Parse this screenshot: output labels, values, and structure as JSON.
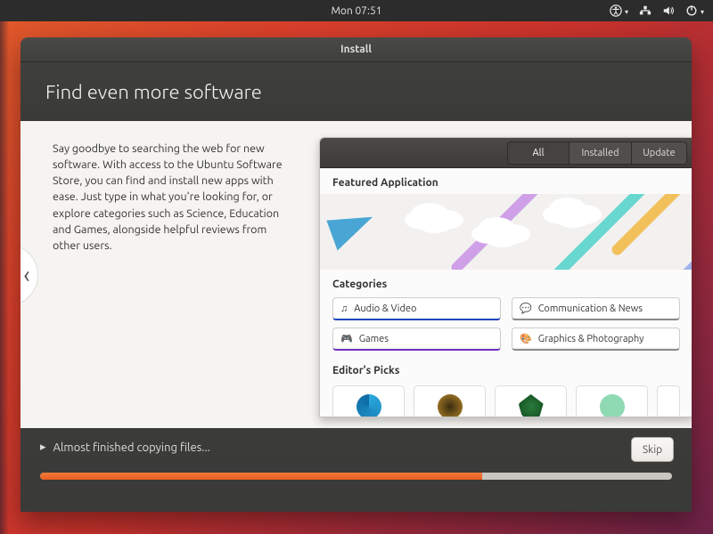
{
  "panel": {
    "clock": "Mon 07:51"
  },
  "window": {
    "title": "Install",
    "heading": "Find even more software",
    "body": "Say goodbye to searching the web for new software. With access to the Ubuntu Software Store, you can find and install new apps with ease. Just type in what you're looking for, or explore categories such as Science, Education and Games, alongside helpful reviews from other users."
  },
  "software": {
    "tabs": {
      "all": "All",
      "installed": "Installed",
      "updates": "Update"
    },
    "featured_title": "Featured Application",
    "categories_title": "Categories",
    "categories": [
      "Audio & Video",
      "Communication & News",
      "Games",
      "Graphics & Photography"
    ],
    "editors_picks_title": "Editor's Picks"
  },
  "footer": {
    "status": "Almost finished copying files...",
    "skip": "Skip",
    "progress_percent": 70
  },
  "colors": {
    "accent": "#e85d20"
  }
}
